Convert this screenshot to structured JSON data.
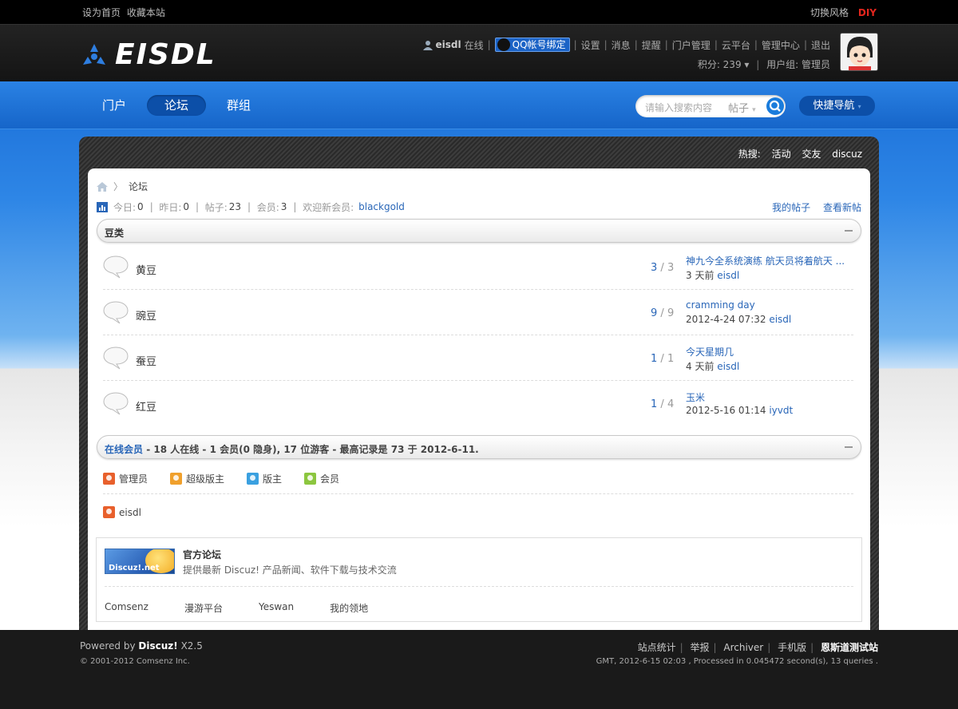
{
  "topbar": {
    "set_home": "设为首页",
    "favorite": "收藏本站",
    "switch_style": "切换风格",
    "diy": "DIY"
  },
  "logo": {
    "text": "EISDL"
  },
  "user": {
    "name": "eisdl",
    "status": "在线",
    "qq_bind": "QQ帐号绑定",
    "links": [
      "设置",
      "消息",
      "提醒",
      "门户管理",
      "云平台",
      "管理中心",
      "退出"
    ],
    "points_label": "积分: 239",
    "group_label": "用户组: 管理员"
  },
  "nav": {
    "items": [
      "门户",
      "论坛",
      "群组"
    ],
    "active": "论坛",
    "quicknav": "快捷导航"
  },
  "search": {
    "placeholder": "请输入搜索内容",
    "type": "帖子"
  },
  "hot": {
    "label": "热搜:",
    "items": [
      "活动",
      "交友",
      "discuz"
    ]
  },
  "breadcrumb": {
    "current": "论坛"
  },
  "stats": {
    "today_label": "今日:",
    "today": "0",
    "yesterday_label": "昨日:",
    "yesterday": "0",
    "posts_label": "帖子:",
    "posts": "23",
    "members_label": "会员:",
    "members": "3",
    "welcome": "欢迎新会员:",
    "newest": "blackgold",
    "my_posts": "我的帖子",
    "new_posts": "查看新帖"
  },
  "category": {
    "title": "豆类"
  },
  "forums": [
    {
      "name": "黄豆",
      "threads": "3",
      "posts": "3",
      "last_title": "神九今全系统演练 航天员将着航天 ...",
      "last_time": "3 天前",
      "last_user": "eisdl"
    },
    {
      "name": "豌豆",
      "threads": "9",
      "posts": "9",
      "last_title": "cramming day",
      "last_time": "2012-4-24 07:32",
      "last_user": "eisdl"
    },
    {
      "name": "蚕豆",
      "threads": "1",
      "posts": "1",
      "last_title": "今天星期几",
      "last_time": "4 天前",
      "last_user": "eisdl"
    },
    {
      "name": "红豆",
      "threads": "1",
      "posts": "4",
      "last_title": "玉米",
      "last_time": "2012-5-16 01:14",
      "last_user": "iyvdt"
    }
  ],
  "online": {
    "link": "在线会员",
    "text": " - 18 人在线 - 1 会员(0 隐身), 17 位游客 - 最高记录是 73 于 2012-6-11.",
    "legend": [
      {
        "label": "管理员",
        "color": "#e8602c"
      },
      {
        "label": "超级版主",
        "color": "#f0a02c"
      },
      {
        "label": "版主",
        "color": "#3aa0e0"
      },
      {
        "label": "会员",
        "color": "#8cc63f"
      }
    ],
    "member": "eisdl"
  },
  "links_box": {
    "banner_text": "Discuz!.net",
    "title": "官方论坛",
    "desc": "提供最新 Discuz! 产品新闻、软件下载与技术交流",
    "text_links": [
      "Comsenz",
      "漫游平台",
      "Yeswan",
      "我的领地"
    ]
  },
  "footer": {
    "powered_prefix": "Powered by",
    "powered_name": "Discuz!",
    "version": "X2.5",
    "copyright": "© 2001-2012 Comsenz Inc.",
    "links": [
      "站点统计",
      "举报",
      "Archiver",
      "手机版"
    ],
    "site_name": "恩斯道测试站",
    "process": "GMT, 2012-6-15 02:03 , Processed in 0.045472 second(s), 13 queries ."
  }
}
